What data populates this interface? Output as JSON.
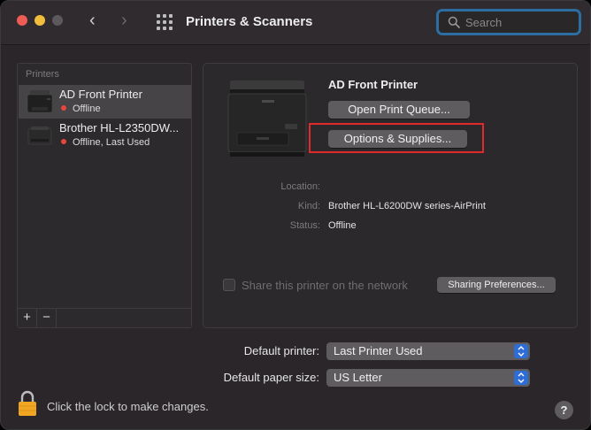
{
  "window": {
    "title": "Printers & Scanners",
    "nav_back": "‹",
    "nav_forward": "›"
  },
  "search": {
    "placeholder": "Search"
  },
  "printer_list": {
    "header": "Printers",
    "items": [
      {
        "name": "AD Front Printer",
        "status": "Offline",
        "selected": true
      },
      {
        "name": "Brother HL-L2350DW...",
        "status": "Offline, Last Used",
        "selected": false
      }
    ],
    "add_label": "+",
    "remove_label": "−"
  },
  "detail": {
    "title": "AD Front Printer",
    "open_queue_label": "Open Print Queue...",
    "options_label": "Options & Supplies...",
    "location_label": "Location:",
    "location_value": "",
    "kind_label": "Kind:",
    "kind_value": "Brother HL-L6200DW series-AirPrint",
    "status_label": "Status:",
    "status_value": "Offline",
    "share_label": "Share this printer on the network",
    "sharing_prefs_label": "Sharing Preferences..."
  },
  "defaults": {
    "printer_label": "Default printer:",
    "printer_value": "Last Printer Used",
    "paper_label": "Default paper size:",
    "paper_value": "US Letter"
  },
  "footer": {
    "lock_text": "Click the lock to make changes.",
    "help_label": "?"
  },
  "colors": {
    "highlight": "#e0292a",
    "status_offline": "#e8453c",
    "accent": "#2f6dd6",
    "search_focus": "#2c6ea1"
  }
}
